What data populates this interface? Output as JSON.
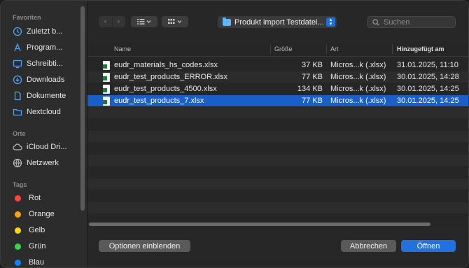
{
  "sidebar": {
    "favorites_label": "Favoriten",
    "favorites": [
      {
        "label": "Zuletzt b...",
        "icon": "clock-icon"
      },
      {
        "label": "Program...",
        "icon": "apps-icon"
      },
      {
        "label": "Schreibti...",
        "icon": "desktop-icon"
      },
      {
        "label": "Downloads",
        "icon": "download-icon"
      },
      {
        "label": "Dokumente",
        "icon": "document-icon"
      },
      {
        "label": "Nextcloud",
        "icon": "folder-icon"
      }
    ],
    "places_label": "Orte",
    "places": [
      {
        "label": "iCloud Dri...",
        "icon": "cloud-icon"
      },
      {
        "label": "Netzwerk",
        "icon": "network-icon"
      }
    ],
    "tags_label": "Tags",
    "tags": [
      {
        "label": "Rot",
        "color": "#ff453a"
      },
      {
        "label": "Orange",
        "color": "#ff9f0a"
      },
      {
        "label": "Gelb",
        "color": "#ffd60a"
      },
      {
        "label": "Grün",
        "color": "#32d74b"
      },
      {
        "label": "Blau",
        "color": "#0a84ff"
      }
    ]
  },
  "toolbar": {
    "location": "Produkt import Testdatei...",
    "search_placeholder": "Suchen"
  },
  "columns": {
    "name": "Name",
    "size": "Größe",
    "kind": "Art",
    "added": "Hinzugefügt am"
  },
  "files": [
    {
      "name": "eudr_materials_hs_codes.xlsx",
      "size": "37 KB",
      "kind": "Micros...k (.xlsx)",
      "added": "31.01.2025, 11:10"
    },
    {
      "name": "eudr_test_products_ERROR.xlsx",
      "size": "77 KB",
      "kind": "Micros...k (.xlsx)",
      "added": "30.01.2025, 14:28"
    },
    {
      "name": "eudr_test_products_4500.xlsx",
      "size": "134 KB",
      "kind": "Micros...k (.xlsx)",
      "added": "30.01.2025, 14:25"
    },
    {
      "name": "eudr_test_products_7.xlsx",
      "size": "77 KB",
      "kind": "Micros...k (.xlsx)",
      "added": "30.01.2025, 14:25"
    }
  ],
  "buttons": {
    "options": "Optionen einblenden",
    "cancel": "Abbrechen",
    "open": "Öffnen"
  },
  "colors": {
    "accent": "#2370e0",
    "selection": "#1a5fc8"
  }
}
